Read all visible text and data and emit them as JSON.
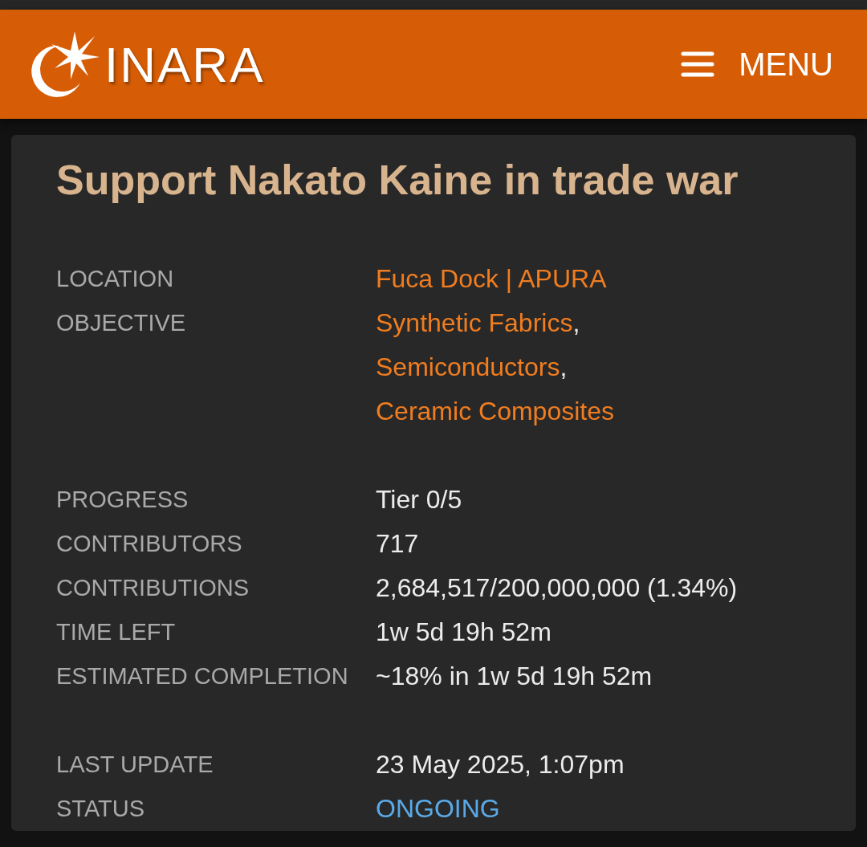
{
  "header": {
    "logo_text": "INARA",
    "menu_label": "MENU"
  },
  "title": "Support Nakato Kaine in trade war",
  "groups": [
    [
      {
        "label": "LOCATION",
        "kind": "links",
        "links": [
          "Fuca Dock | APURA"
        ]
      },
      {
        "label": "OBJECTIVE",
        "kind": "links",
        "links": [
          "Synthetic Fabrics",
          "Semiconductors",
          "Ceramic Composites"
        ],
        "separator": ","
      }
    ],
    [
      {
        "label": "PROGRESS",
        "kind": "text",
        "value": "Tier 0/5"
      },
      {
        "label": "CONTRIBUTORS",
        "kind": "text",
        "value": "717"
      },
      {
        "label": "CONTRIBUTIONS",
        "kind": "text",
        "value": "2,684,517/200,000,000 (1.34%)"
      },
      {
        "label": "TIME LEFT",
        "kind": "text",
        "value": "1w 5d 19h 52m"
      },
      {
        "label": "ESTIMATED COMPLETION",
        "kind": "text",
        "value": "~18% in 1w 5d 19h 52m"
      }
    ],
    [
      {
        "label": "LAST UPDATE",
        "kind": "text",
        "value": "23 May 2025, 1:07pm"
      },
      {
        "label": "STATUS",
        "kind": "status",
        "value": "ONGOING"
      }
    ]
  ]
}
